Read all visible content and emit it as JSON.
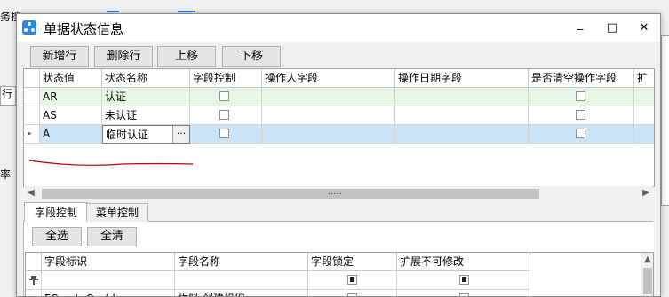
{
  "background": {
    "left_fragment_1": "务搜",
    "left_fragment_2": "率",
    "left_fragment_3": "行"
  },
  "dialog": {
    "title": "单据状态信息",
    "window_buttons": {
      "minimize": "_",
      "maximize": "□",
      "close": "✕"
    }
  },
  "toolbar": {
    "add_row": "新增行",
    "delete_row": "删除行",
    "move_up": "上移",
    "move_down": "下移"
  },
  "status_grid": {
    "columns": [
      "状态值",
      "状态名称",
      "字段控制",
      "操作人字段",
      "操作日期字段",
      "是否清空操作字段",
      "扩"
    ],
    "rows": [
      {
        "value": "AR",
        "name": "认证",
        "field_control": false,
        "operator_field": "",
        "date_field": "",
        "clear": false,
        "selected": false,
        "highlight": true
      },
      {
        "value": "AS",
        "name": "未认证",
        "field_control": false,
        "operator_field": "",
        "date_field": "",
        "clear": false,
        "selected": false,
        "highlight": false
      },
      {
        "value": "A",
        "name": "临时认证",
        "field_control": false,
        "operator_field": "",
        "date_field": "",
        "clear": false,
        "selected": true,
        "highlight": false
      }
    ],
    "row_marker": "▸",
    "ellipsis_button": "···"
  },
  "splitter_handle": "·····",
  "tabs": [
    {
      "label": "字段控制",
      "active": true
    },
    {
      "label": "菜单控制",
      "active": false
    }
  ],
  "field_panel": {
    "select_all": "全选",
    "clear_all": "全清",
    "columns": [
      "字段标识",
      "字段名称",
      "字段锁定",
      "扩展不可修改"
    ],
    "filter_icon": "pin-icon",
    "partial_row": {
      "id": "FCreateOrgId",
      "name": "物料.创建组织"
    }
  },
  "colors": {
    "selected_row": "#cce4f7",
    "highlight_row": "#e6f7e6",
    "accent": "#2e86de",
    "annotation": "#c00000"
  }
}
